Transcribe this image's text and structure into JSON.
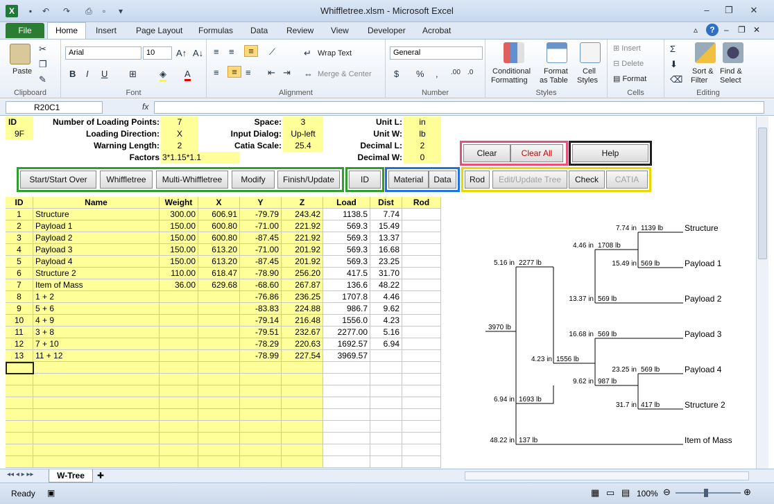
{
  "window": {
    "title": "Whiffletree.xlsm - Microsoft Excel",
    "logo": "X"
  },
  "ribbon_tabs": {
    "file": "File",
    "home": "Home",
    "items": [
      "Insert",
      "Page Layout",
      "Formulas",
      "Data",
      "Review",
      "View",
      "Developer",
      "Acrobat"
    ]
  },
  "ribbon": {
    "clipboard": {
      "label": "Clipboard",
      "paste": "Paste"
    },
    "font": {
      "label": "Font",
      "name": "Arial",
      "size": "10",
      "bold": "B",
      "italic": "I",
      "underline": "U"
    },
    "alignment": {
      "label": "Alignment",
      "wrap": "Wrap Text",
      "merge": "Merge & Center"
    },
    "number": {
      "label": "Number",
      "format": "General",
      "currency": "$",
      "percent": "%",
      "comma": ","
    },
    "styles": {
      "label": "Styles",
      "cond": [
        "Conditional",
        "Formatting"
      ],
      "table": [
        "Format",
        "as Table"
      ],
      "cell": [
        "Cell",
        "Styles"
      ]
    },
    "cells": {
      "label": "Cells",
      "insert": "Insert",
      "delete": "Delete",
      "format": "Format"
    },
    "editing": {
      "label": "Editing",
      "sum": "Σ",
      "sort": [
        "Sort &",
        "Filter"
      ],
      "find": [
        "Find &",
        "Select"
      ]
    }
  },
  "formula_bar": {
    "name_box": "R20C1",
    "fx": "fx",
    "value": ""
  },
  "params": {
    "id_label": "ID",
    "id_value": "9F",
    "num_points_label": "Number of Loading Points:",
    "num_points": "7",
    "load_dir_label": "Loading Direction:",
    "load_dir": "X",
    "warn_len_label": "Warning Length:",
    "warn_len": "2",
    "factors_label": "Factors",
    "factors": "3*1.15*1.1",
    "space_label": "Space:",
    "space": "3",
    "input_dialog_label": "Input Dialog:",
    "input_dialog": "Up-left",
    "catia_scale_label": "Catia Scale:",
    "catia_scale": "25.4",
    "unit_l_label": "Unit L:",
    "unit_l": "in",
    "unit_w_label": "Unit W:",
    "unit_w": "lb",
    "decimal_l_label": "Decimal L:",
    "decimal_l": "2",
    "decimal_w_label": "Decimal W:",
    "decimal_w": "0"
  },
  "buttons": {
    "clear": "Clear",
    "clear_all": "Clear All",
    "help": "Help",
    "start": "Start/Start Over",
    "whiffletree": "Whiffletree",
    "multi": "Multi-Whiffletree",
    "modify": "Modify",
    "finish": "Finish/Update",
    "id": "ID",
    "material": "Material",
    "data": "Data",
    "rod": "Rod",
    "edit_tree": "Edit/Update Tree",
    "check": "Check",
    "catia": "CATIA"
  },
  "table": {
    "headers": [
      "ID",
      "Name",
      "Weight",
      "X",
      "Y",
      "Z",
      "Load",
      "Dist",
      "Rod"
    ],
    "rows": [
      [
        "1",
        "Structure",
        "300.00",
        "606.91",
        "-79.79",
        "243.42",
        "1138.5",
        "7.74",
        ""
      ],
      [
        "2",
        "Payload 1",
        "150.00",
        "600.80",
        "-71.00",
        "221.92",
        "569.3",
        "15.49",
        ""
      ],
      [
        "3",
        "Payload 2",
        "150.00",
        "600.80",
        "-87.45",
        "221.92",
        "569.3",
        "13.37",
        ""
      ],
      [
        "4",
        "Payload 3",
        "150.00",
        "613.20",
        "-71.00",
        "201.92",
        "569.3",
        "16.68",
        ""
      ],
      [
        "5",
        "Payload 4",
        "150.00",
        "613.20",
        "-87.45",
        "201.92",
        "569.3",
        "23.25",
        ""
      ],
      [
        "6",
        "Structure 2",
        "110.00",
        "618.47",
        "-78.90",
        "256.20",
        "417.5",
        "31.70",
        ""
      ],
      [
        "7",
        "Item of Mass",
        "36.00",
        "629.68",
        "-68.60",
        "267.87",
        "136.6",
        "48.22",
        ""
      ],
      [
        "8",
        "1 + 2",
        "",
        "",
        "-76.86",
        "236.25",
        "1707.8",
        "4.46",
        ""
      ],
      [
        "9",
        "5 + 6",
        "",
        "",
        "-83.83",
        "224.88",
        "986.7",
        "9.62",
        ""
      ],
      [
        "10",
        "4 + 9",
        "",
        "",
        "-79.14",
        "216.48",
        "1556.0",
        "4.23",
        ""
      ],
      [
        "11",
        "3 + 8",
        "",
        "",
        "-79.51",
        "232.67",
        "2277.00",
        "5.16",
        ""
      ],
      [
        "12",
        "7 + 10",
        "",
        "",
        "-78.29",
        "220.63",
        "1692.57",
        "6.94",
        ""
      ],
      [
        "13",
        "11 + 12",
        "",
        "",
        "-78.99",
        "227.54",
        "3969.57",
        "",
        ""
      ]
    ]
  },
  "tree": {
    "leaves": [
      "Structure",
      "Payload 1",
      "Payload 2",
      "Payload 3",
      "Payload 4",
      "Structure 2",
      "Item of Mass"
    ],
    "labels": [
      {
        "d": "7.74 in",
        "w": "1139 lb"
      },
      {
        "d": "4.46 in",
        "w": "1708 lb"
      },
      {
        "d": "15.49 in",
        "w": "569 lb"
      },
      {
        "d": "5.16 in",
        "w": "2277 lb"
      },
      {
        "d": "13.37 in",
        "w": "569 lb"
      },
      {
        "d": "",
        "w": "3970 lb"
      },
      {
        "d": "16.68 in",
        "w": "569 lb"
      },
      {
        "d": "4.23 in",
        "w": "1556 lb"
      },
      {
        "d": "23.25 in",
        "w": "569 lb"
      },
      {
        "d": "9.62 in",
        "w": "987 lb"
      },
      {
        "d": "6.94 in",
        "w": "1693 lb"
      },
      {
        "d": "31.7 in",
        "w": "417 lb"
      },
      {
        "d": "48.22 in",
        "w": "137 lb"
      }
    ]
  },
  "sheet_tab": "W-Tree",
  "status": {
    "ready": "Ready",
    "zoom": "100%"
  }
}
